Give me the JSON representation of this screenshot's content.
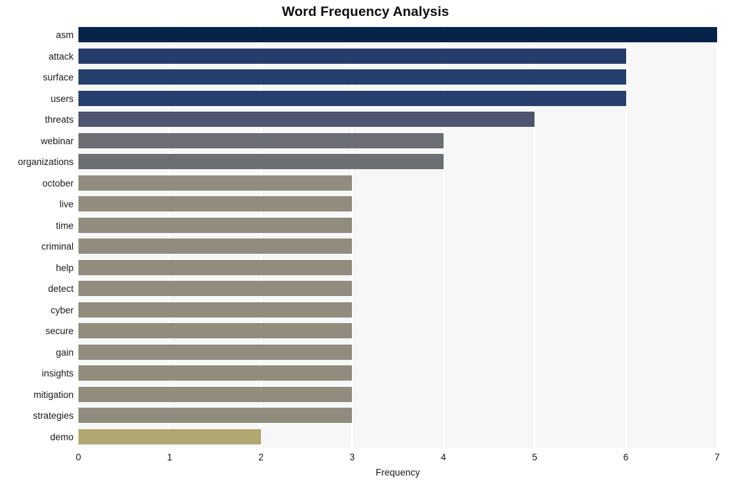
{
  "chart_data": {
    "type": "bar",
    "orientation": "horizontal",
    "title": "Word Frequency Analysis",
    "xlabel": "Frequency",
    "ylabel": "",
    "xlim": [
      0,
      7
    ],
    "xticks": [
      0,
      1,
      2,
      3,
      4,
      5,
      6,
      7
    ],
    "xtick_labels": [
      "0",
      "1",
      "2",
      "3",
      "4",
      "5",
      "6",
      "7"
    ],
    "grid": true,
    "grid_axis": "x",
    "grid_color": "#ffffff",
    "plot_background": "#f7f7f7",
    "figure_background": "#ffffff",
    "legend": null,
    "categories": [
      "asm",
      "attack",
      "surface",
      "users",
      "threats",
      "webinar",
      "organizations",
      "october",
      "live",
      "time",
      "criminal",
      "help",
      "detect",
      "cyber",
      "secure",
      "gain",
      "insights",
      "mitigation",
      "strategies",
      "demo"
    ],
    "values": [
      7,
      6,
      6,
      6,
      5,
      4,
      4,
      3,
      3,
      3,
      3,
      3,
      3,
      3,
      3,
      3,
      3,
      3,
      3,
      2
    ],
    "bar_colors": [
      "#06244a",
      "#253c6b",
      "#253f6d",
      "#263f6e",
      "#4f5470",
      "#6c6e74",
      "#6c6e74",
      "#918c7e",
      "#918c7e",
      "#918c7e",
      "#918c7e",
      "#918c7e",
      "#918c7e",
      "#918c7e",
      "#918c7e",
      "#918c7e",
      "#918c7e",
      "#918c7e",
      "#918c7e",
      "#b0a870"
    ]
  }
}
